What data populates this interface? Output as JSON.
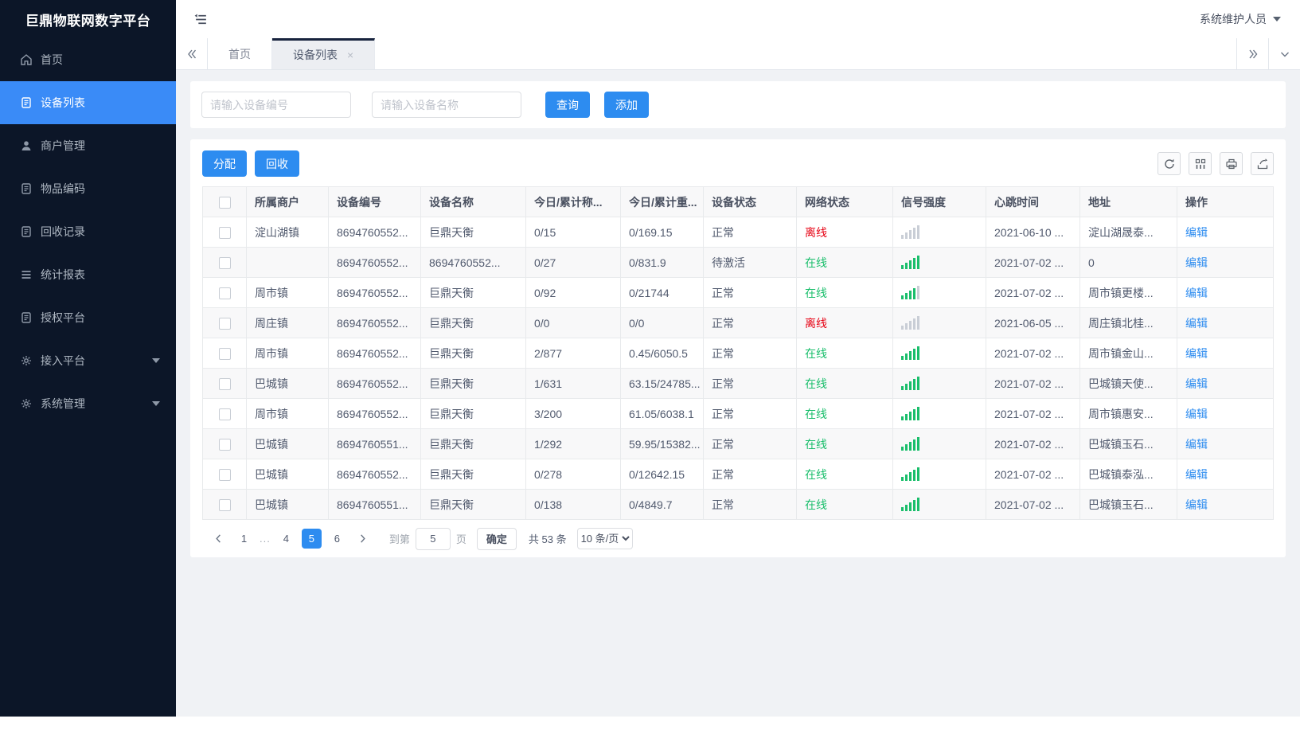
{
  "app": {
    "title": "巨鼎物联网数字平台",
    "user": "系统维护人员"
  },
  "colors": {
    "accent": "#2d8cf0",
    "success": "#19be6b",
    "danger": "#e60012",
    "sidebar_bg": "#0c1628",
    "active_item": "#3a8bf7"
  },
  "sidebar": {
    "items": [
      {
        "label": "首页",
        "icon": "home-icon",
        "active": false
      },
      {
        "label": "设备列表",
        "icon": "device-list-icon",
        "active": true
      },
      {
        "label": "商户管理",
        "icon": "merchant-icon",
        "active": false
      },
      {
        "label": "物品编码",
        "icon": "item-code-icon",
        "active": false
      },
      {
        "label": "回收记录",
        "icon": "recycle-record-icon",
        "active": false
      },
      {
        "label": "统计报表",
        "icon": "report-icon",
        "active": false
      },
      {
        "label": "授权平台",
        "icon": "auth-platform-icon",
        "active": false
      },
      {
        "label": "接入平台",
        "icon": "gear-icon",
        "active": false,
        "expandable": true
      },
      {
        "label": "系统管理",
        "icon": "gear-icon",
        "active": false,
        "expandable": true
      }
    ]
  },
  "tabs": {
    "items": [
      {
        "label": "首页",
        "active": false,
        "closable": false
      },
      {
        "label": "设备列表",
        "active": true,
        "closable": true
      }
    ]
  },
  "search": {
    "device_no_placeholder": "请输入设备编号",
    "device_name_placeholder": "请输入设备名称",
    "query_label": "查询",
    "add_label": "添加"
  },
  "toolbar": {
    "assign_label": "分配",
    "recycle_label": "回收",
    "icons": [
      "refresh-icon",
      "columns-icon",
      "print-icon",
      "export-icon"
    ]
  },
  "table": {
    "headers": [
      "所属商户",
      "设备编号",
      "设备名称",
      "今日/累计称...",
      "今日/累计重...",
      "设备状态",
      "网络状态",
      "信号强度",
      "心跳时间",
      "地址",
      "操作"
    ],
    "rows": [
      {
        "merchant": "淀山湖镇",
        "device_no": "8694760552...",
        "device_name": "巨鼎天衡",
        "today_count": "0/15",
        "today_weight": "0/169.15",
        "device_status": "正常",
        "network_status": "离线",
        "signal": 0,
        "heartbeat": "2021-06-10 ...",
        "address": "淀山湖晟泰...",
        "action": "编辑"
      },
      {
        "merchant": "",
        "device_no": "8694760552...",
        "device_name": "8694760552...",
        "today_count": "0/27",
        "today_weight": "0/831.9",
        "device_status": "待激活",
        "network_status": "在线",
        "signal": 5,
        "heartbeat": "2021-07-02 ...",
        "address": "0",
        "action": "编辑"
      },
      {
        "merchant": "周市镇",
        "device_no": "8694760552...",
        "device_name": "巨鼎天衡",
        "today_count": "0/92",
        "today_weight": "0/21744",
        "device_status": "正常",
        "network_status": "在线",
        "signal": 4,
        "heartbeat": "2021-07-02 ...",
        "address": "周市镇更楼...",
        "action": "编辑"
      },
      {
        "merchant": "周庄镇",
        "device_no": "8694760552...",
        "device_name": "巨鼎天衡",
        "today_count": "0/0",
        "today_weight": "0/0",
        "device_status": "正常",
        "network_status": "离线",
        "signal": 0,
        "heartbeat": "2021-06-05 ...",
        "address": "周庄镇北桂...",
        "action": "编辑"
      },
      {
        "merchant": "周市镇",
        "device_no": "8694760552...",
        "device_name": "巨鼎天衡",
        "today_count": "2/877",
        "today_weight": "0.45/6050.5",
        "device_status": "正常",
        "network_status": "在线",
        "signal": 5,
        "heartbeat": "2021-07-02 ...",
        "address": "周市镇金山...",
        "action": "编辑"
      },
      {
        "merchant": "巴城镇",
        "device_no": "8694760552...",
        "device_name": "巨鼎天衡",
        "today_count": "1/631",
        "today_weight": "63.15/24785...",
        "device_status": "正常",
        "network_status": "在线",
        "signal": 5,
        "heartbeat": "2021-07-02 ...",
        "address": "巴城镇天使...",
        "action": "编辑"
      },
      {
        "merchant": "周市镇",
        "device_no": "8694760552...",
        "device_name": "巨鼎天衡",
        "today_count": "3/200",
        "today_weight": "61.05/6038.1",
        "device_status": "正常",
        "network_status": "在线",
        "signal": 5,
        "heartbeat": "2021-07-02 ...",
        "address": "周市镇惠安...",
        "action": "编辑"
      },
      {
        "merchant": "巴城镇",
        "device_no": "8694760551...",
        "device_name": "巨鼎天衡",
        "today_count": "1/292",
        "today_weight": "59.95/15382...",
        "device_status": "正常",
        "network_status": "在线",
        "signal": 5,
        "heartbeat": "2021-07-02 ...",
        "address": "巴城镇玉石...",
        "action": "编辑"
      },
      {
        "merchant": "巴城镇",
        "device_no": "8694760552...",
        "device_name": "巨鼎天衡",
        "today_count": "0/278",
        "today_weight": "0/12642.15",
        "device_status": "正常",
        "network_status": "在线",
        "signal": 5,
        "heartbeat": "2021-07-02 ...",
        "address": "巴城镇泰泓...",
        "action": "编辑"
      },
      {
        "merchant": "巴城镇",
        "device_no": "8694760551...",
        "device_name": "巨鼎天衡",
        "today_count": "0/138",
        "today_weight": "0/4849.7",
        "device_status": "正常",
        "network_status": "在线",
        "signal": 5,
        "heartbeat": "2021-07-02 ...",
        "address": "巴城镇玉石...",
        "action": "编辑"
      }
    ]
  },
  "pagination": {
    "pages": [
      "1",
      "...",
      "4",
      "5",
      "6"
    ],
    "active_page": "5",
    "goto_label": "到第",
    "jump_value": "5",
    "page_word": "页",
    "confirm_label": "确定",
    "total_label": "共 53 条",
    "page_size": "10 条/页"
  }
}
